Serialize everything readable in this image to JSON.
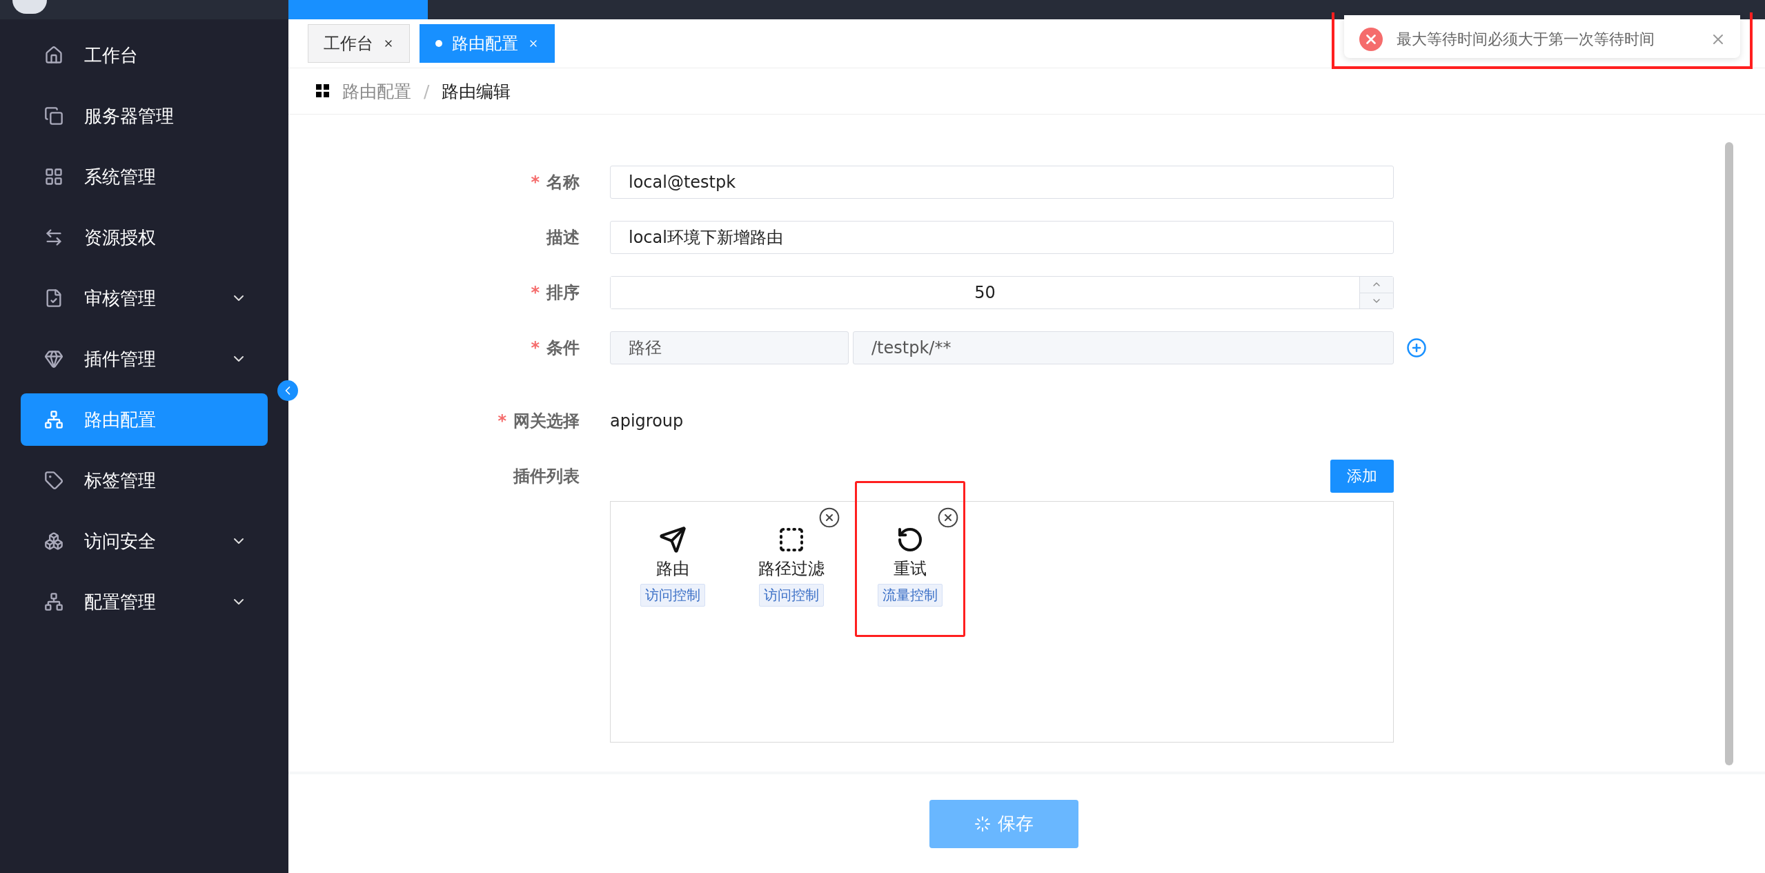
{
  "sidebar": {
    "items": [
      {
        "label": "工作台",
        "submenu": false,
        "selected": false
      },
      {
        "label": "服务器管理",
        "submenu": false,
        "selected": false
      },
      {
        "label": "系统管理",
        "submenu": false,
        "selected": false
      },
      {
        "label": "资源授权",
        "submenu": false,
        "selected": false
      },
      {
        "label": "审核管理",
        "submenu": true,
        "selected": false
      },
      {
        "label": "插件管理",
        "submenu": true,
        "selected": false
      },
      {
        "label": "路由配置",
        "submenu": false,
        "selected": true
      },
      {
        "label": "标签管理",
        "submenu": false,
        "selected": false
      },
      {
        "label": "访问安全",
        "submenu": true,
        "selected": false
      },
      {
        "label": "配置管理",
        "submenu": true,
        "selected": false
      }
    ]
  },
  "tabs": [
    {
      "label": "工作台",
      "selected": false
    },
    {
      "label": "路由配置",
      "selected": true
    }
  ],
  "breadcrumb": {
    "items": [
      "路由配置",
      "路由编辑"
    ],
    "separator": "/"
  },
  "form": {
    "required_mark": "*",
    "fields": [
      {
        "kind": "text",
        "label": "名称",
        "required": true,
        "value": "local@testpk"
      },
      {
        "kind": "text",
        "label": "描述",
        "required": false,
        "value": "local环境下新增路由"
      },
      {
        "kind": "number",
        "label": "排序",
        "required": true,
        "value": "50"
      },
      {
        "kind": "condition",
        "label": "条件",
        "required": true,
        "type": "路径",
        "value": "/testpk/**"
      },
      {
        "kind": "static",
        "label": "网关选择",
        "required": true,
        "value": "apigroup"
      },
      {
        "kind": "plugins",
        "label": "插件列表",
        "required": false,
        "add_button": "添加",
        "plugins": [
          {
            "name": "路由",
            "tag": "访问控制",
            "removable": false,
            "highlighted": false
          },
          {
            "name": "路径过滤",
            "tag": "访问控制",
            "removable": true,
            "highlighted": false
          },
          {
            "name": "重试",
            "tag": "流量控制",
            "removable": true,
            "highlighted": true
          }
        ]
      }
    ]
  },
  "save_button": {
    "label": "保存",
    "loading": true
  },
  "toast": {
    "kind": "error",
    "message": "最大等待时间必须大于第一次等待时间",
    "highlighted": true
  }
}
